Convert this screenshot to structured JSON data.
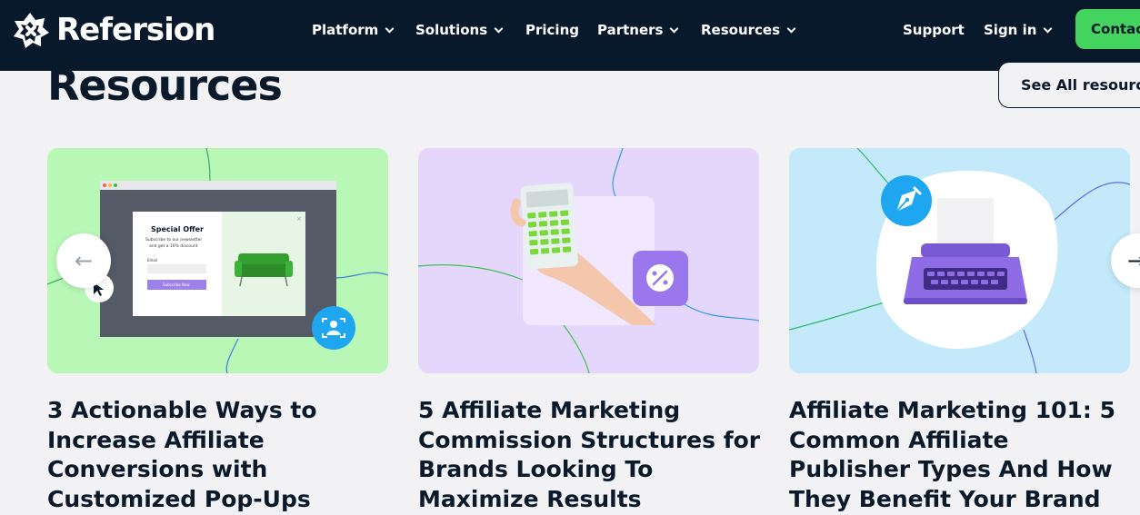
{
  "brand": {
    "name": "Refersion",
    "logo_icon": "refersion-logo-icon"
  },
  "nav": {
    "items": [
      {
        "label": "Platform",
        "dropdown": true
      },
      {
        "label": "Solutions",
        "dropdown": true
      },
      {
        "label": "Pricing",
        "dropdown": false
      },
      {
        "label": "Partners",
        "dropdown": true
      },
      {
        "label": "Resources",
        "dropdown": true
      }
    ],
    "support": "Support",
    "sign_in": "Sign in",
    "contact": "Contact",
    "colors": {
      "background": "#08192b",
      "accent": "#45d35f"
    }
  },
  "resources": {
    "title": "Resources",
    "see_all": "See All resources",
    "cards": [
      {
        "title": "3 Actionable Ways to Increase Affiliate Conversions with Customized Pop-Ups",
        "bg_color": "#b9f7b7",
        "illustration": {
          "popup_heading": "Special Offer",
          "popup_text_1": "Subscribe to our newsletter",
          "popup_text_2": "and get a 10% discount",
          "field_label": "Email",
          "button_label": "Subscribe Now"
        },
        "icon": "user-scan-icon"
      },
      {
        "title": "5 Affiliate Marketing Commission Structures for Brands Looking To Maximize Results",
        "bg_color": "#e4d7fb",
        "icon": "percent-icon"
      },
      {
        "title": "Affiliate Marketing 101: 5 Common Affiliate Publisher Types And How They Benefit Your Brand",
        "bg_color": "#c3e9fa",
        "icon": "pen-nib-icon"
      }
    ],
    "prev_arrow": "←",
    "next_arrow": "→"
  }
}
